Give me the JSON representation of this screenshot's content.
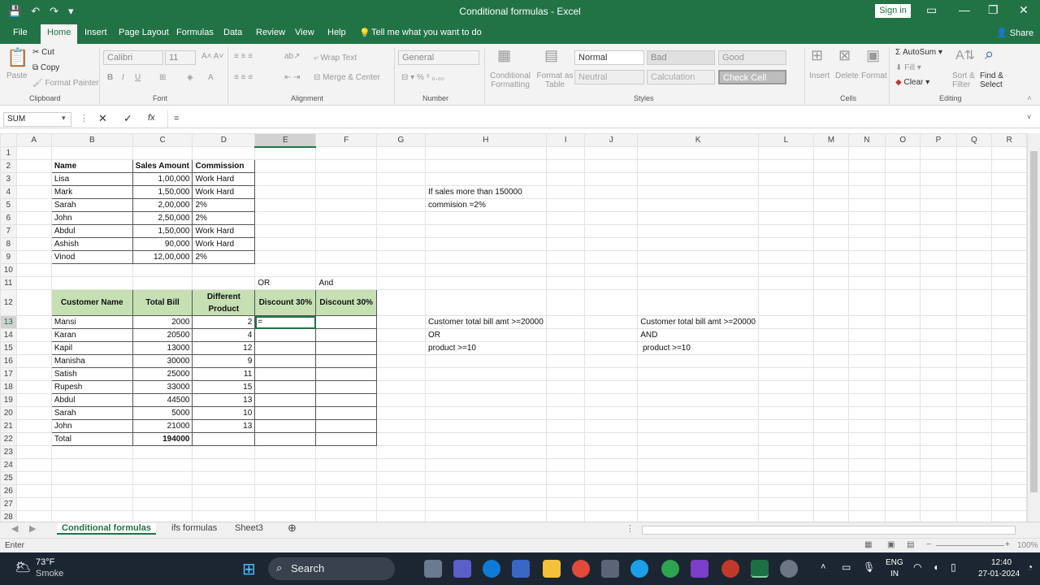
{
  "window": {
    "title": "Conditional formulas  -  Excel",
    "sign_in": "Sign in",
    "share": "Share"
  },
  "tabs": [
    "File",
    "Home",
    "Insert",
    "Page Layout",
    "Formulas",
    "Data",
    "Review",
    "View",
    "Help",
    "Tell me what you want to do"
  ],
  "ribbon": {
    "clipboard": {
      "paste": "Paste",
      "cut": "Cut",
      "copy": "Copy",
      "format_painter": "Format Painter",
      "group": "Clipboard"
    },
    "font": {
      "name": "Calibri",
      "size": "11",
      "group": "Font"
    },
    "alignment": {
      "wrap": "Wrap Text",
      "merge": "Merge & Center",
      "group": "Alignment"
    },
    "number": {
      "format": "General",
      "group": "Number"
    },
    "styles": {
      "cond": "Conditional Formatting",
      "fmt_table": "Format as Table",
      "normal": "Normal",
      "bad": "Bad",
      "good": "Good",
      "neutral": "Neutral",
      "calculation": "Calculation",
      "check_cell": "Check Cell",
      "group": "Styles"
    },
    "cells": {
      "insert": "Insert",
      "delete": "Delete",
      "format": "Format",
      "group": "Cells"
    },
    "editing": {
      "autosum": "AutoSum",
      "fill": "Fill",
      "clear": "Clear",
      "sort": "Sort & Filter",
      "find": "Find & Select",
      "group": "Editing"
    }
  },
  "formula_bar": {
    "name_box": "SUM",
    "fx": "fx",
    "content": "="
  },
  "columns": [
    "A",
    "B",
    "C",
    "D",
    "E",
    "F",
    "G",
    "H",
    "I",
    "J",
    "K",
    "L",
    "M",
    "N",
    "O",
    "P",
    "Q",
    "R"
  ],
  "cells": {
    "B2": "Name",
    "C2": "Sales Amount",
    "D2": "Commission",
    "B3": "Lisa",
    "C3": "1,00,000",
    "D3": "Work Hard",
    "B4": "Mark",
    "C4": "1,50,000",
    "D4": "Work Hard",
    "B5": "Sarah",
    "C5": "2,00,000",
    "D5": "2%",
    "B6": "John",
    "C6": "2,50,000",
    "D6": "2%",
    "B7": "Abdul",
    "C7": "1,50,000",
    "D7": "Work Hard",
    "B8": "Ashish",
    "C8": "90,000",
    "D8": "Work Hard",
    "B9": "Vinod",
    "C9": "12,00,000",
    "D9": "2%",
    "H4": "If sales more than 150000",
    "H5": "commision =2%",
    "E11": "OR",
    "F11": "And",
    "B12": "Customer Name",
    "C12": "Total Bill",
    "D12a": "Different",
    "D12b": "Product",
    "E12": "Discount 30%",
    "F12": "Discount 30%",
    "B13": "Mansi",
    "C13": "2000",
    "D13": "2",
    "E13": "=",
    "B14": "Karan",
    "C14": "20500",
    "D14": "4",
    "B15": "Kapil",
    "C15": "13000",
    "D15": "12",
    "B16": "Manisha",
    "C16": "30000",
    "D16": "9",
    "B17": "Satish",
    "C17": "25000",
    "D17": "11",
    "B18": "Rupesh",
    "C18": "33000",
    "D18": "15",
    "B19": "Abdul",
    "C19": "44500",
    "D19": "13",
    "B20": "Sarah",
    "C20": "5000",
    "D20": "10",
    "B21": "John",
    "C21": "21000",
    "D21": "13",
    "B22": "Total",
    "C22": "194000",
    "H13": "Customer total bill amt >=20000",
    "H14": "OR",
    "H15": "product >=10",
    "K13": "Customer total bill amt >=20000",
    "K14": "AND",
    "K15": " product >=10"
  },
  "sheets": [
    "Conditional formulas",
    "ifs formulas",
    "Sheet3"
  ],
  "status": {
    "mode": "Enter",
    "zoom": "100%"
  },
  "taskbar": {
    "temp": "73°F",
    "weather": "Smoke",
    "search": "Search",
    "lang1": "ENG",
    "lang2": "IN",
    "time": "12:40",
    "date": "27-01-2024"
  }
}
